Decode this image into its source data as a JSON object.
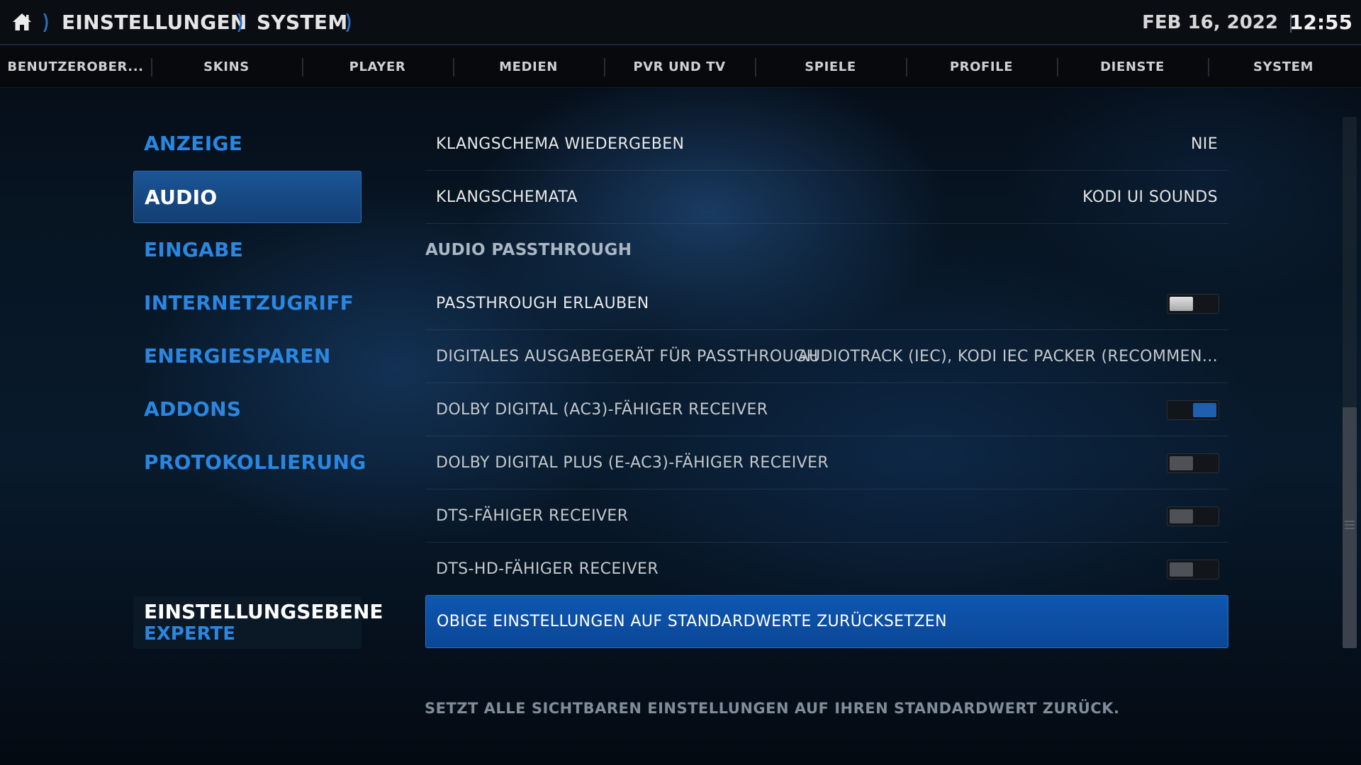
{
  "header": {
    "breadcrumbs": [
      "EINSTELLUNGEN",
      "SYSTEM"
    ],
    "date": "FEB 16, 2022",
    "time": "12:55"
  },
  "tabs": [
    "BENUTZEROBER...",
    "SKINS",
    "PLAYER",
    "MEDIEN",
    "PVR UND TV",
    "SPIELE",
    "PROFILE",
    "DIENSTE",
    "SYSTEM"
  ],
  "categories": [
    {
      "label": "ANZEIGE",
      "active": false
    },
    {
      "label": "AUDIO",
      "active": true
    },
    {
      "label": "EINGABE",
      "active": false
    },
    {
      "label": "INTERNETZUGRIFF",
      "active": false
    },
    {
      "label": "ENERGIESPAREN",
      "active": false
    },
    {
      "label": "ADDONS",
      "active": false
    },
    {
      "label": "PROTOKOLLIERUNG",
      "active": false
    }
  ],
  "settings_level": {
    "title": "EINSTELLUNGSEBENE",
    "value": "EXPERTE"
  },
  "settings": {
    "klangschema": {
      "label": "KLANGSCHEMA WIEDERGEBEN",
      "value": "NIE"
    },
    "klangschemata": {
      "label": "KLANGSCHEMATA",
      "value": "KODI UI SOUNDS"
    },
    "section_passthrough": "AUDIO PASSTHROUGH",
    "passthrough": {
      "label": "PASSTHROUGH ERLAUBEN",
      "state": "off"
    },
    "output_device": {
      "label": "DIGITALES AUSGABEGERÄT FÜR PASSTHROUGH",
      "value": "AUDIOTRACK (IEC), KODI IEC PACKER (RECOMMEN..."
    },
    "ac3": {
      "label": "DOLBY DIGITAL (AC3)-FÄHIGER RECEIVER",
      "state": "on"
    },
    "eac3": {
      "label": "DOLBY DIGITAL PLUS (E-AC3)-FÄHIGER RECEIVER",
      "state": "off"
    },
    "dts": {
      "label": "DTS-FÄHIGER RECEIVER",
      "state": "off"
    },
    "dtshd": {
      "label": "DTS-HD-FÄHIGER RECEIVER",
      "state": "off"
    },
    "reset": {
      "label": "OBIGE EINSTELLUNGEN AUF STANDARDWERTE ZURÜCKSETZEN"
    }
  },
  "description": "SETZT ALLE SICHTBAREN EINSTELLUNGEN AUF IHREN STANDARDWERT ZURÜCK.",
  "colors": {
    "accent": "#2a86e0",
    "selection": "#0e57b0",
    "toggle_on": "#1f5fae"
  }
}
